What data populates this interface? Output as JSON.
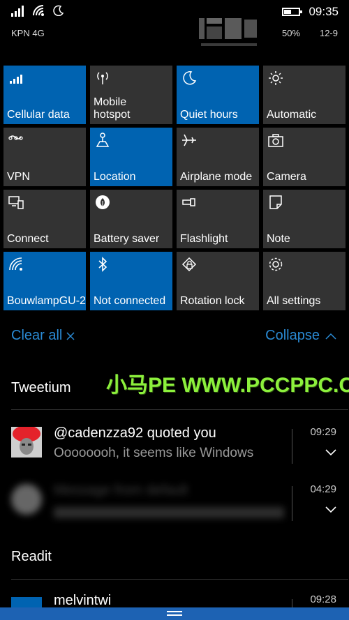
{
  "status_bar": {
    "carrier": "KPN 4G",
    "time": "09:35",
    "battery_percent": "50%",
    "battery_level": 0.5,
    "date": "12-9"
  },
  "quick_actions": [
    {
      "label": "Cellular data",
      "icon": "signal-icon",
      "active": true
    },
    {
      "label": "Mobile hotspot",
      "icon": "hotspot-icon",
      "active": false
    },
    {
      "label": "Quiet hours",
      "icon": "moon-icon",
      "active": true
    },
    {
      "label": "Automatic",
      "icon": "brightness-icon",
      "active": false
    },
    {
      "label": "VPN",
      "icon": "vpn-icon",
      "active": false
    },
    {
      "label": "Location",
      "icon": "location-icon",
      "active": true
    },
    {
      "label": "Airplane mode",
      "icon": "airplane-icon",
      "active": false
    },
    {
      "label": "Camera",
      "icon": "camera-icon",
      "active": false
    },
    {
      "label": "Connect",
      "icon": "connect-icon",
      "active": false
    },
    {
      "label": "Battery saver",
      "icon": "battery-saver-icon",
      "active": false
    },
    {
      "label": "Flashlight",
      "icon": "flashlight-icon",
      "active": false
    },
    {
      "label": "Note",
      "icon": "note-icon",
      "active": false
    },
    {
      "label": "BouwlampGU-2",
      "icon": "wifi-icon",
      "active": true
    },
    {
      "label": "Not connected",
      "icon": "bluetooth-icon",
      "active": true
    },
    {
      "label": "Rotation lock",
      "icon": "rotation-lock-icon",
      "active": false
    },
    {
      "label": "All settings",
      "icon": "gear-icon",
      "active": false
    }
  ],
  "actions": {
    "clear_all": "Clear all",
    "collapse": "Collapse"
  },
  "groups": [
    {
      "app": "Tweetium",
      "notifications": [
        {
          "title": "@cadenzza92 quoted you",
          "body": "Oooooooh, it seems like Windows",
          "time": "09:29"
        },
        {
          "title": "Message from default",
          "body": "",
          "time": "04:29"
        }
      ]
    },
    {
      "app": "Readit",
      "notifications": [
        {
          "title": "melvintwi",
          "body": "",
          "time": "09:28"
        }
      ]
    }
  ],
  "watermark": "小马PE WWW.PCCPPC.COM",
  "colors": {
    "accent": "#0063b1",
    "tile_off": "#333333",
    "link": "#2a8ad4",
    "background": "#000000"
  }
}
